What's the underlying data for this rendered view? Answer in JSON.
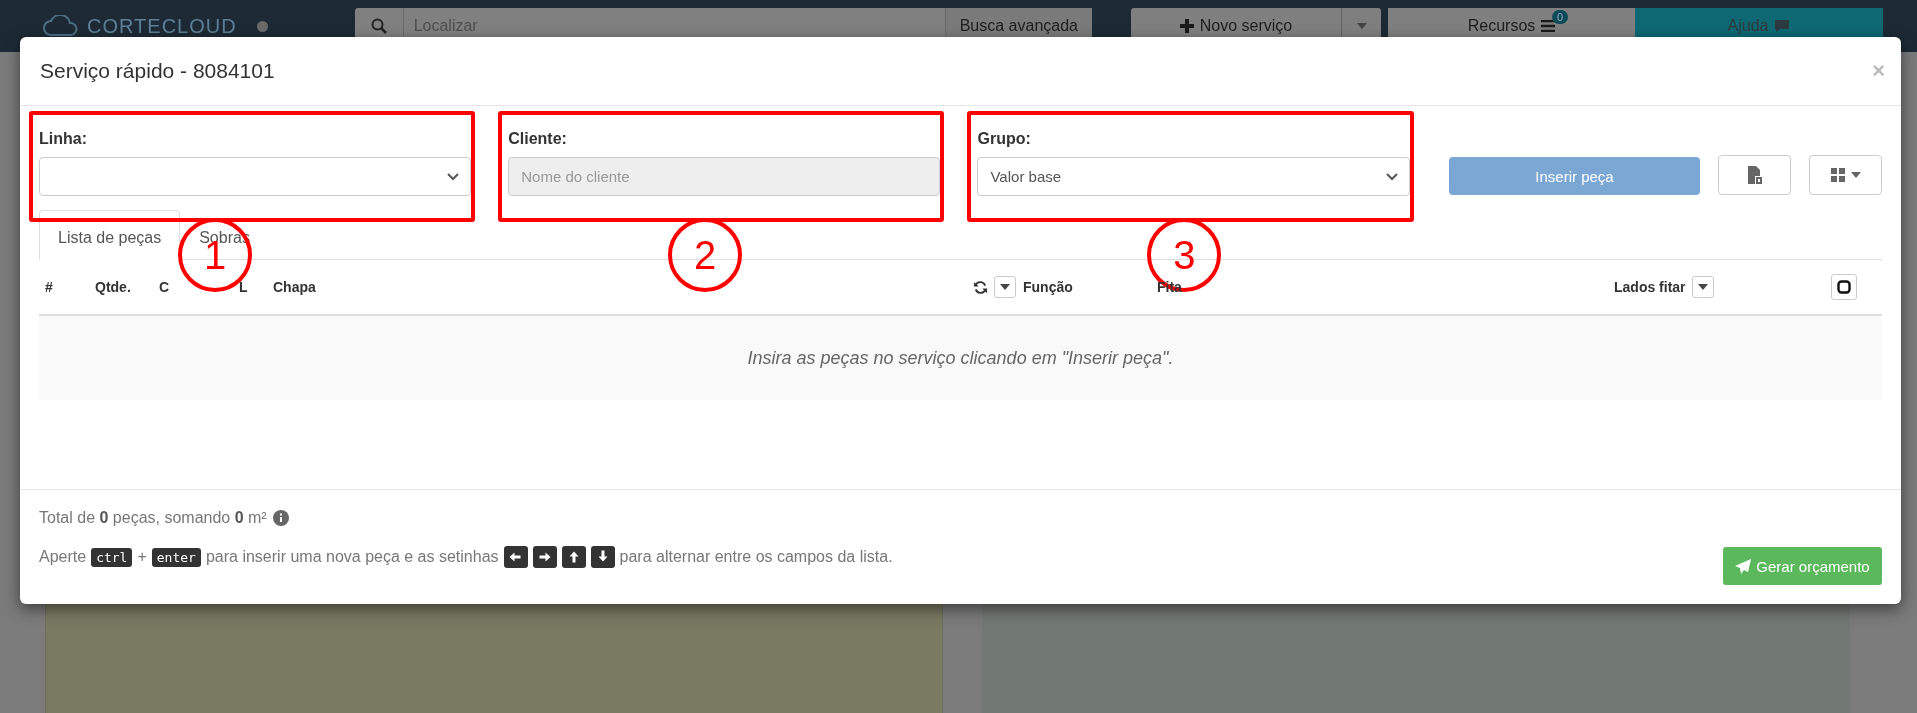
{
  "app_bar": {
    "logo": "CORTECLOUD",
    "search": {
      "placeholder": "Localizar"
    },
    "advanced_search": "Busca avançada",
    "new_service": "Novo serviço",
    "resources": "Recursos",
    "resources_badge": "0",
    "help": "Ajuda"
  },
  "dialog": {
    "title": "Serviço rápido - 8084101",
    "close": "×",
    "fields": [
      {
        "kind": "select",
        "label": "Linha:",
        "marker": "1"
      },
      {
        "kind": "text",
        "label": "Cliente:",
        "placeholder": "Nome do cliente",
        "disabled": true,
        "marker": "2"
      },
      {
        "kind": "select",
        "label": "Grupo:",
        "value": "Valor base",
        "marker": "3"
      }
    ],
    "insert_button": {
      "label": "Inserir peça",
      "disabled": true
    },
    "tabs": [
      {
        "label": "Lista de peças",
        "selected": true
      },
      {
        "label": "Sobras",
        "selected": false
      }
    ],
    "columns": [
      {
        "label": "#",
        "kind": "plain"
      },
      {
        "label": "Qtde.",
        "kind": "plain"
      },
      {
        "label": "C",
        "kind": "plain"
      },
      {
        "label": "L",
        "kind": "plain"
      },
      {
        "label": "Chapa",
        "kind": "refresh"
      },
      {
        "label": "Função",
        "kind": "plain"
      },
      {
        "label": "Fita",
        "kind": "plain"
      },
      {
        "label": "Lados fitar",
        "kind": "dropdown"
      },
      {
        "kind": "checkbox"
      }
    ],
    "empty_message": "Insira as peças no serviço clicando em \"Inserir peça\".",
    "summary": "Total de **0** peças, somando **0** m²",
    "hint": [
      {
        "kind": "text",
        "text": "Aperte"
      },
      {
        "kind": "key",
        "text": "ctrl"
      },
      {
        "kind": "text",
        "text": "+"
      },
      {
        "kind": "key",
        "text": "enter"
      },
      {
        "kind": "text",
        "text": "para inserir uma nova peça e as setinhas"
      },
      {
        "kind": "left"
      },
      {
        "kind": "right"
      },
      {
        "kind": "up"
      },
      {
        "kind": "down"
      },
      {
        "kind": "text",
        "text": "para alternar entre os campos da lista."
      }
    ],
    "generate_button": "Gerar orçamento"
  }
}
